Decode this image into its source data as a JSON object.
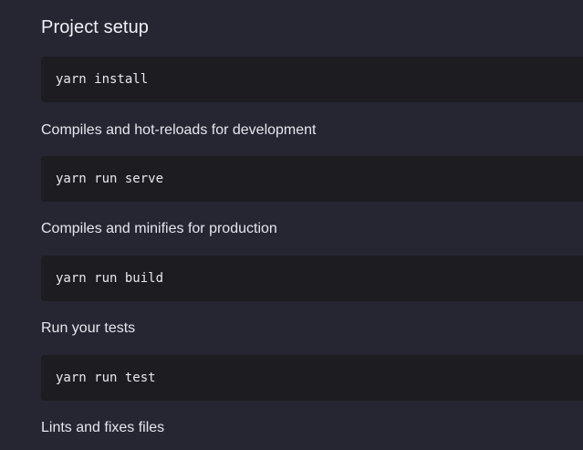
{
  "readme": {
    "heading": "Project setup",
    "commands": {
      "install": "yarn install",
      "serve": "yarn run serve",
      "build": "yarn run build",
      "test": "yarn run test"
    },
    "sections": {
      "serve_label": "Compiles and hot-reloads for development",
      "build_label": "Compiles and minifies for production",
      "test_label": "Run your tests",
      "lint_label": "Lints and fixes files"
    }
  }
}
